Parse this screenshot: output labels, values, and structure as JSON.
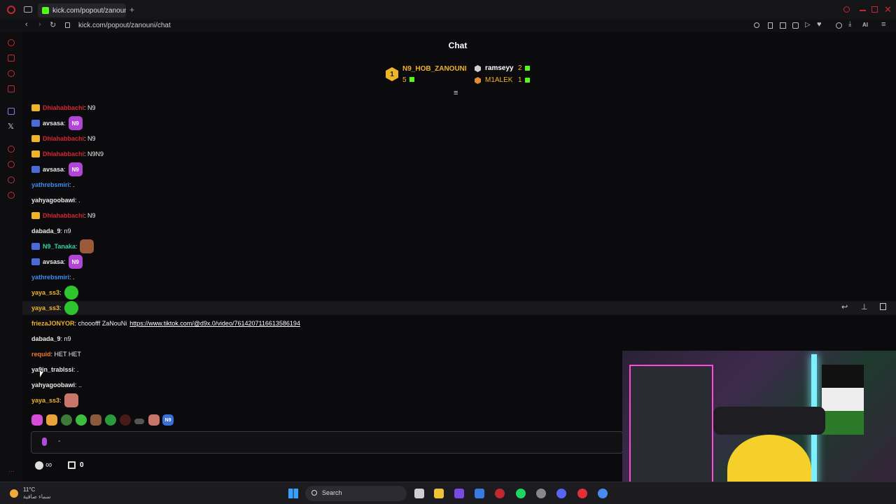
{
  "browser": {
    "tab_title": "kick.com/popout/zanouni/",
    "new_tab_label": "+",
    "url": "kick.com/popout/zanouni/chat"
  },
  "chat": {
    "title": "Chat",
    "leaderboard": {
      "first_name": "N9_HOB_ZANOUNI",
      "first_count": "5",
      "second_name": "ramseyy",
      "second_count": "2",
      "third_name": "M1ALEK",
      "third_count": "1",
      "rank_badge": "1"
    },
    "messages": [
      {
        "user": "Dhiahabbachi",
        "text": ": N9",
        "color": "#d8262f",
        "badge": "crown",
        "emote": ""
      },
      {
        "user": "avsasa",
        "text": ":",
        "color": "#e8e8e8",
        "badge": "n9",
        "emote": "N9"
      },
      {
        "user": "Dhiahabbachi",
        "text": ": N9",
        "color": "#d8262f",
        "badge": "crown",
        "emote": ""
      },
      {
        "user": "Dhiahabbachi",
        "text": ": N9N9",
        "color": "#d8262f",
        "badge": "crown",
        "emote": ""
      },
      {
        "user": "avsasa",
        "text": ":",
        "color": "#e8e8e8",
        "badge": "n9",
        "emote": "N9"
      },
      {
        "user": "yathrebsmiri",
        "text": ": .",
        "color": "#3a8df5",
        "badge": "",
        "emote": ""
      },
      {
        "user": "yahyagoobawi",
        "text": ": .",
        "color": "#e8e8e8",
        "badge": "",
        "emote": ""
      },
      {
        "user": "Dhiahabbachi",
        "text": ": N9",
        "color": "#d8262f",
        "badge": "crown",
        "emote": ""
      },
      {
        "user": "dabada_9",
        "text": ": n9",
        "color": "#e8e8e8",
        "badge": "",
        "emote": ""
      },
      {
        "user": "N9_Tanaka",
        "text": ":",
        "color": "#2fd3a6",
        "badge": "n9",
        "emote": "face"
      },
      {
        "user": "avsasa",
        "text": ":",
        "color": "#e8e8e8",
        "badge": "n9",
        "emote": "N9"
      },
      {
        "user": "yathrebsmiri",
        "text": ": .",
        "color": "#3a8df5",
        "badge": "",
        "emote": ""
      },
      {
        "user": "yaya_ss3",
        "text": ":",
        "color": "#f0b429",
        "badge": "",
        "emote": "green"
      },
      {
        "user": "yaya_ss3",
        "text": ":",
        "color": "#f0b429",
        "badge": "",
        "emote": "green2"
      },
      {
        "user": "friezaJONYOR",
        "text": ": chooofff ZaNouNi",
        "color": "#f0b429",
        "badge": "",
        "emote": "",
        "link": "https://www.tiktok.com/@d9x.0/video/7614207116613586194"
      },
      {
        "user": "dabada_9",
        "text": ": n9",
        "color": "#e8e8e8",
        "badge": "",
        "emote": ""
      },
      {
        "user": "requid",
        "text": ": HET HET",
        "color": "#f07a2a",
        "badge": "",
        "emote": ""
      },
      {
        "user": "ya9in_trablssi",
        "text": ": .",
        "color": "#e8e8e8",
        "badge": "",
        "emote": ""
      },
      {
        "user": "yahyagoobawi",
        "text": ": ..",
        "color": "#e8e8e8",
        "badge": "",
        "emote": ""
      },
      {
        "user": "yaya_ss3",
        "text": ":",
        "color": "#f0b429",
        "badge": "",
        "emote": "red"
      }
    ],
    "points": "0",
    "input_placeholder": "-"
  },
  "taskbar": {
    "weather_temp": "11°C",
    "weather_desc": "سماء صافية",
    "search_label": "Search"
  },
  "colors": {
    "accent": "#53fc18",
    "background": "#0b0b0d"
  }
}
